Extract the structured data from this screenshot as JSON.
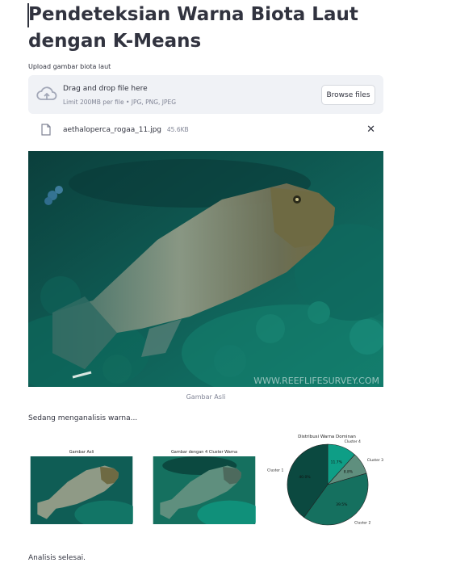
{
  "title": "Pendeteksian Warna Biota Laut dengan K-Means",
  "uploader": {
    "label": "Upload gambar biota laut",
    "drop_title": "Drag and drop file here",
    "drop_sub": "Limit 200MB per file • JPG, PNG, JPEG",
    "browse_label": "Browse files"
  },
  "file": {
    "name": "aethaloperca_rogaa_11.jpg",
    "size": "45.6KB",
    "close_icon": "close-icon"
  },
  "image": {
    "watermark": "WWW.REEFLIFESURVEY.COM",
    "caption": "Gambar Asli"
  },
  "status_text": "Sedang menganalisis warna...",
  "figures": {
    "original_title": "Gambar Asli",
    "clustered_title": "Gambar dengan 4 Cluster Warna"
  },
  "done_text": "Analisis selesai.",
  "chart_data": {
    "type": "pie",
    "title": "Distribusi Warna Dominan",
    "series": [
      {
        "name": "Cluster 4",
        "percent": 11.7,
        "label": "11.7%",
        "color": "#0e9e86"
      },
      {
        "name": "Cluster 3",
        "percent": 8.8,
        "label": "8.8%",
        "color": "#5f8f7e"
      },
      {
        "name": "Cluster 2",
        "percent": 39.5,
        "label": "39.5%",
        "color": "#15705f"
      },
      {
        "name": "Cluster 1",
        "percent": 40.0,
        "label": "40.0%",
        "color": "#0b4940"
      }
    ]
  }
}
